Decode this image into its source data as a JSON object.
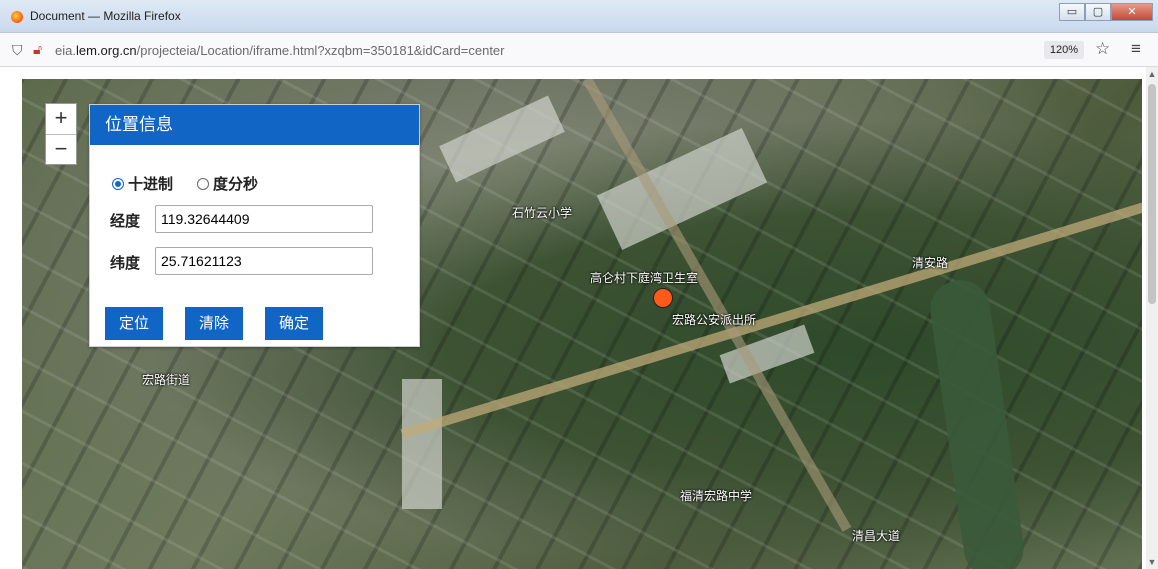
{
  "window": {
    "title": "Document — Mozilla Firefox",
    "minimize_label": "▭",
    "maximize_label": "▢",
    "close_label": "✕"
  },
  "urlbar": {
    "prefix": "eia.",
    "host": "lem.org.cn",
    "path": "/projecteia/Location/iframe.html?xzqbm=350181&idCard=center",
    "zoom": "120%"
  },
  "map": {
    "zoom_in": "+",
    "zoom_out": "−",
    "labels": [
      {
        "text": "高仑村下庭湾卫生室",
        "id": "label-clinic"
      },
      {
        "text": "宏路公安派出所",
        "id": "label-police"
      },
      {
        "text": "石竹云小学",
        "id": "label-school"
      },
      {
        "text": "清安路",
        "id": "label-road"
      },
      {
        "text": "宏路街道",
        "id": "label-street"
      },
      {
        "text": "福清宏路中学",
        "id": "label-middle-school"
      },
      {
        "text": "清昌大道",
        "id": "label-avenue"
      }
    ]
  },
  "panel": {
    "title": "位置信息",
    "format_options": [
      {
        "label": "十进制",
        "selected": true
      },
      {
        "label": "度分秒",
        "selected": false
      }
    ],
    "longitude_label": "经度",
    "longitude_value": "119.32644409",
    "latitude_label": "纬度",
    "latitude_value": "25.71621123",
    "buttons": {
      "locate": "定位",
      "clear": "清除",
      "confirm": "确定"
    }
  },
  "colors": {
    "accent": "#1165c4",
    "marker": "#ff5a1a"
  }
}
